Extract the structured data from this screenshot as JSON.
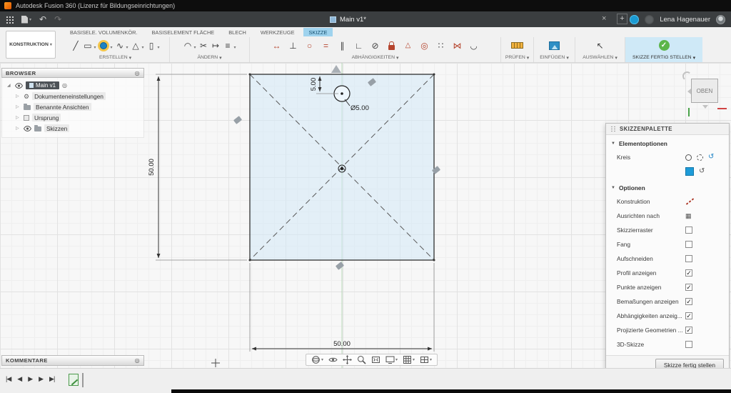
{
  "title_bar": {
    "app_title": "Autodesk Fusion 360 (Lizenz für Bildungseinrichtungen)"
  },
  "tab_bar": {
    "document_tab": "Main v1*",
    "user_name": "Lena Hagenauer"
  },
  "ribbon": {
    "context_button": "KONSTRUKTION",
    "tabs": [
      "BASISELE. VOLUMENKÖR.",
      "BASISELEMENT FLÄCHE",
      "BLECH",
      "WERKZEUGE",
      "SKIZZE"
    ],
    "active_tab": "SKIZZE",
    "group_labels": {
      "create": "ERSTELLEN",
      "modify": "ÄNDERN",
      "constraints": "ABHÄNGIGKEITEN",
      "inspect": "PRÜFEN",
      "insert": "EINFÜGEN",
      "select": "AUSWÄHLEN",
      "finish": "SKIZZE FERTIG STELLEN"
    }
  },
  "browser": {
    "title": "BROWSER",
    "root_label": "Main v1",
    "items": [
      {
        "label": "Dokumenteneinstellungen"
      },
      {
        "label": "Benannte Ansichten"
      },
      {
        "label": "Ursprung"
      },
      {
        "label": "Skizzen"
      }
    ]
  },
  "viewcube": {
    "face": "OBEN"
  },
  "sketch": {
    "width_dim": "50.00",
    "height_dim": "50.00",
    "offset_dim": "5.00",
    "diameter_dim": "Ø5.00"
  },
  "palette": {
    "title": "SKIZZENPALETTE",
    "section_element_options": "Elementoptionen",
    "element_label": "Kreis",
    "section_options": "Optionen",
    "options": [
      {
        "label": "Konstruktion"
      },
      {
        "label": "Ausrichten nach"
      },
      {
        "label": "Skizzierraster",
        "mark": ""
      },
      {
        "label": "Fang",
        "mark": ""
      },
      {
        "label": "Aufschneiden",
        "mark": ""
      },
      {
        "label": "Profil anzeigen",
        "mark": "✓"
      },
      {
        "label": "Punkte anzeigen",
        "mark": "✓"
      },
      {
        "label": "Bemaßungen anzeigen",
        "mark": "✓"
      },
      {
        "label": "Abhängigkeiten anzeig...",
        "mark": "✓"
      },
      {
        "label": "Projizierte Geometrien ...",
        "mark": "✓"
      },
      {
        "label": "3D-Skizze",
        "mark": ""
      }
    ],
    "finish_button": "Skizze fertig stellen"
  },
  "comments": {
    "title": "KOMMENTARE"
  },
  "timeline": {
    "controls": [
      {
        "name": "skip-start",
        "glyph": "|◀"
      },
      {
        "name": "step-back",
        "glyph": "◀"
      },
      {
        "name": "play",
        "glyph": "▶"
      },
      {
        "name": "step-forward",
        "glyph": "▶"
      },
      {
        "name": "skip-end",
        "glyph": "▶|"
      }
    ]
  },
  "glyphs": {
    "chevron_down": "▾",
    "section_open": "▼",
    "undo": "↶",
    "redo": "↷",
    "close": "×",
    "plus": "+",
    "line": "╱",
    "rectangle": "▭",
    "spline": "∿",
    "polygon": "△",
    "slot": "▯",
    "fillet": "◠",
    "trim": "✂",
    "extend": "↦",
    "offset": "≡",
    "dimension": "↔",
    "horizontal_vertical": "⊥",
    "coincident": "○",
    "equal": "=",
    "parallel": "∥",
    "perpendicular": "∟",
    "tangent": "⊘",
    "midpoint": "△",
    "concentric": "◎",
    "collinear": "∷",
    "symmetry": "⋈",
    "curvature": "◡",
    "select": "↖",
    "check": "✓",
    "rotate": "↺",
    "grid_small": "▦",
    "expander_open": "◢",
    "expander_closed": "▷",
    "target": "◎"
  },
  "colors": {
    "accent_blue": "#0696d7",
    "active_tab_highlight": "#9fd3ee",
    "finish_panel_blue": "#cfe9f7",
    "profile_fill_blue": "#cfe7f8",
    "check_green": "#5cb54a",
    "constraint_red": "#b5442d"
  }
}
